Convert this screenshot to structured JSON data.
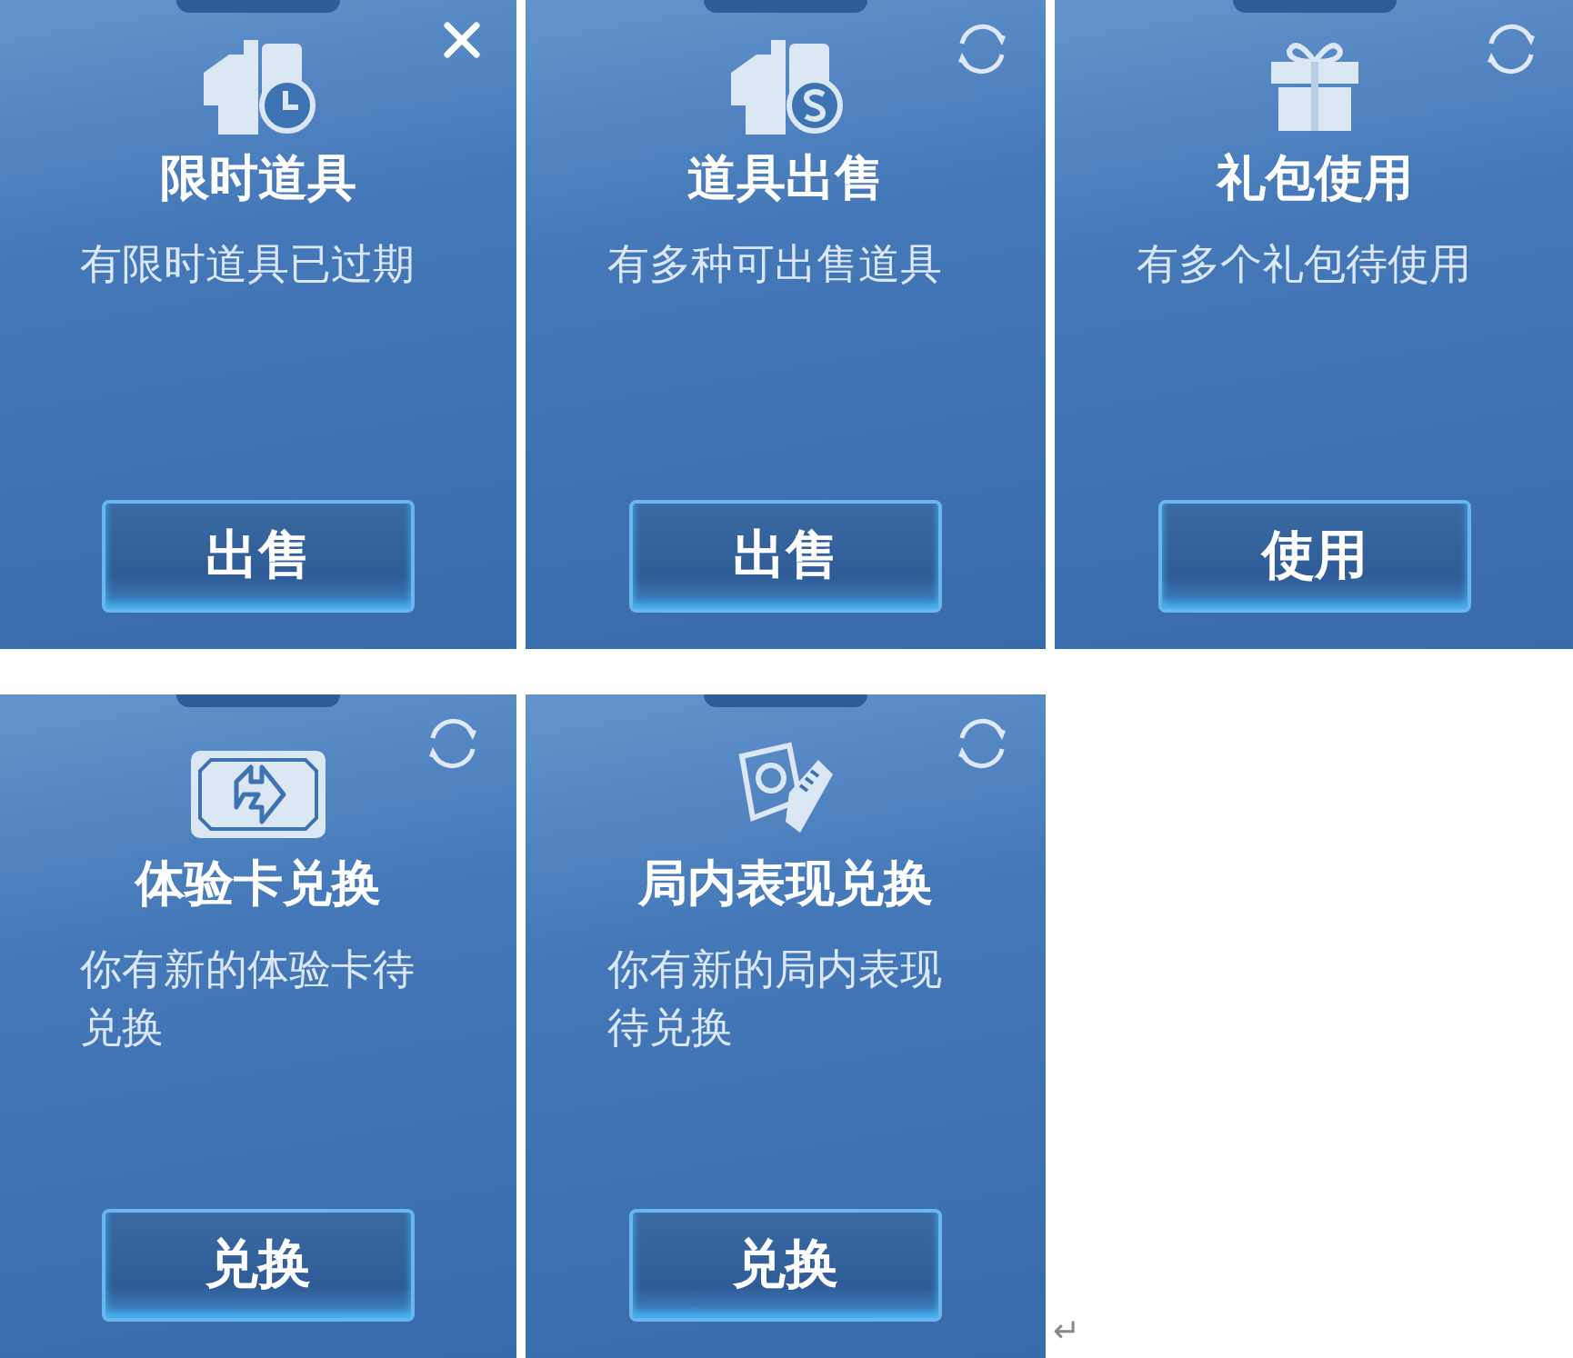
{
  "cards": [
    {
      "kind": "closable",
      "title": "限时道具",
      "description": "有限时道具已过期",
      "button": "出售"
    },
    {
      "kind": "refreshable",
      "title": "道具出售",
      "description": "有多种可出售道具",
      "button": "出售"
    },
    {
      "kind": "refreshable",
      "title": "礼包使用",
      "description": "有多个礼包待使用",
      "button": "使用"
    },
    {
      "kind": "refreshable",
      "title": "体验卡兑换",
      "description": "你有新的体验卡待兑换",
      "button": "兑换"
    },
    {
      "kind": "refreshable",
      "title": "局内表现兑换",
      "description": "你有新的局内表现待兑换",
      "button": "兑换"
    }
  ],
  "paragraph_mark": "↵"
}
